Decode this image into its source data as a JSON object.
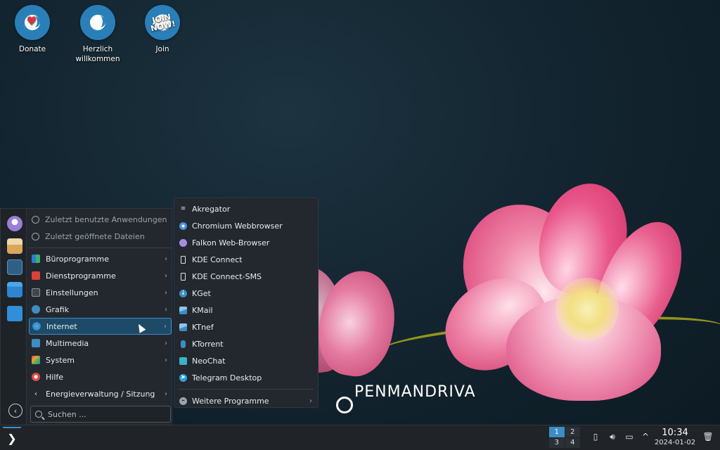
{
  "desktop": {
    "icons": [
      {
        "label": "Donate"
      },
      {
        "label_line1": "Herzlich",
        "label_line2": "willkommen"
      },
      {
        "label": "Join",
        "badge_text_1": "JOIN",
        "badge_text_2": "NOW!"
      }
    ],
    "brand": {
      "letter": "O",
      "rest": "PENMANDRIVA"
    }
  },
  "launcher": {
    "items": [
      {
        "label": "Zuletzt benutzte Anwendungen",
        "icon": "clock-icon"
      },
      {
        "label": "Zuletzt geöffnete Dateien",
        "icon": "clock-icon"
      },
      {
        "label": "Büroprogramme",
        "icon": "office-icon",
        "arrow": "›"
      },
      {
        "label": "Dienstprogramme",
        "icon": "utilities-icon",
        "arrow": "›"
      },
      {
        "label": "Einstellungen",
        "icon": "settings-icon",
        "arrow": "›"
      },
      {
        "label": "Grafik",
        "icon": "graphics-icon",
        "arrow": "›"
      },
      {
        "label": "Internet",
        "icon": "globe-icon",
        "arrow": "›"
      },
      {
        "label": "Multimedia",
        "icon": "multimedia-icon",
        "arrow": "›"
      },
      {
        "label": "System",
        "icon": "system-icon",
        "arrow": "›"
      },
      {
        "label": "Hilfe",
        "icon": "help-icon"
      },
      {
        "label": "Energieverwaltung / Sitzung",
        "icon": "chevron-left-icon",
        "arrow": "›"
      }
    ],
    "search_placeholder": "Suchen ..."
  },
  "submenu": {
    "items": [
      {
        "label": "Akregator",
        "color": "#cfd3d6"
      },
      {
        "label": "Chromium Webbrowser",
        "color": "#4a90d9"
      },
      {
        "label": "Falkon Web-Browser",
        "color": "#a78be0"
      },
      {
        "label": "KDE Connect",
        "color": "#dfe3e6"
      },
      {
        "label": "KDE Connect-SMS",
        "color": "#dfe3e6"
      },
      {
        "label": "KGet",
        "color": "#3d8dc4"
      },
      {
        "label": "KMail",
        "color": "#3d8dc4"
      },
      {
        "label": "KTnef",
        "color": "#3d8dc4"
      },
      {
        "label": "KTorrent",
        "color": "#3d8dc4"
      },
      {
        "label": "NeoChat",
        "color": "#3fb0c9"
      },
      {
        "label": "Telegram Desktop",
        "color": "#2aa3de"
      }
    ],
    "more": {
      "label": "Weitere Programme",
      "arrow": "›"
    }
  },
  "taskbar": {
    "pager": [
      "1",
      "2",
      "3",
      "4"
    ],
    "time": "10:34",
    "date": "2024-01-02"
  },
  "colors": {
    "accent": "#3d8dc4",
    "panel": "#23282e"
  }
}
